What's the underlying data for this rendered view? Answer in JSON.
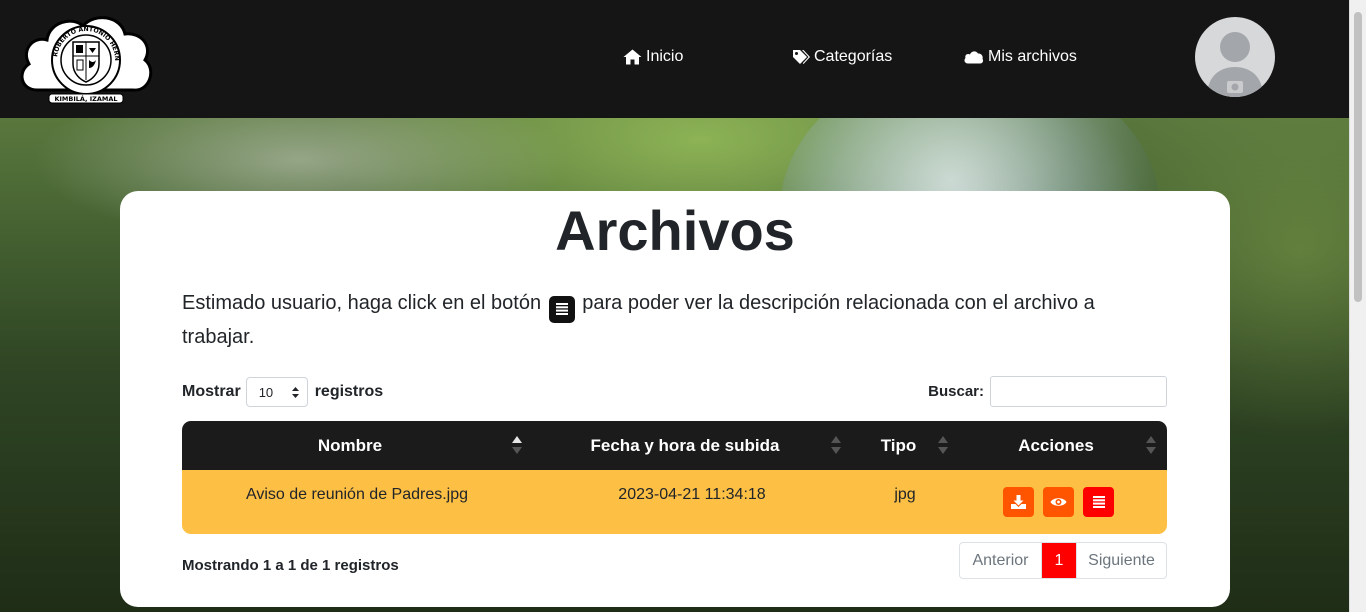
{
  "nav": {
    "items": [
      {
        "label": "Inicio",
        "icon": "home-icon"
      },
      {
        "label": "Categorías",
        "icon": "tags-icon"
      },
      {
        "label": "Mis archivos",
        "icon": "cloud-icon"
      }
    ],
    "logo_text_top": "ROBERTO ANTONIO HERNÁNDEZ NABOUR",
    "logo_text_bottom": "KIMBILÁ, IZAMAL"
  },
  "main": {
    "title": "Archivos",
    "intro_before": "Estimado usuario, haga click en el botón",
    "intro_after": "para poder ver la descripción relacionada con el archivo a trabajar.",
    "length": {
      "label_before": "Mostrar",
      "value": "10",
      "label_after": "registros"
    },
    "search": {
      "label": "Buscar:",
      "value": ""
    },
    "table": {
      "columns": [
        "Nombre",
        "Fecha y hora de subida",
        "Tipo",
        "Acciones"
      ],
      "rows": [
        {
          "nombre": "Aviso de reunión de Padres.jpg",
          "fecha": "2023-04-21 11:34:18",
          "tipo": "jpg"
        }
      ]
    },
    "info": "Mostrando 1 a 1 de 1 registros",
    "pagination": {
      "prev": "Anterior",
      "current": "1",
      "next": "Siguiente"
    }
  },
  "colors": {
    "navbar": "#151515",
    "row_highlight": "#fdbf44",
    "action_red": "#ff0000",
    "action_orange": "#ff5500",
    "page_active": "#ff0000"
  }
}
